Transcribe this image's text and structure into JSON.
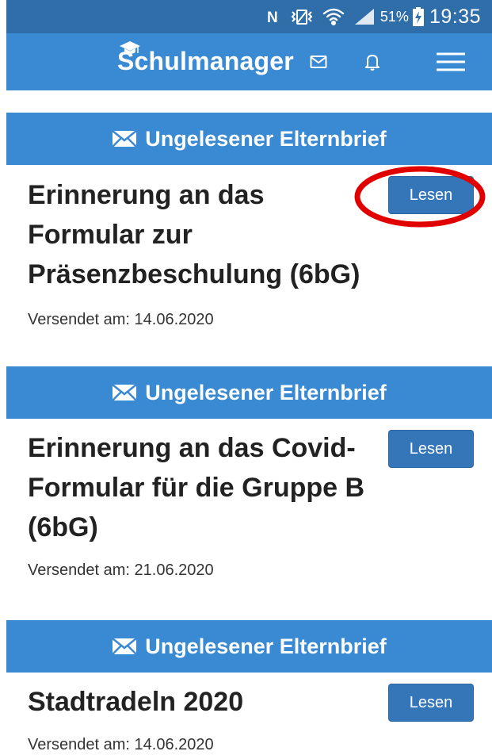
{
  "status_bar": {
    "icons": [
      "nfc-icon",
      "vibrate-icon",
      "wifi-icon",
      "signal-icon",
      "battery-charging-icon"
    ],
    "battery": "51%",
    "time": "19:35"
  },
  "header": {
    "app_name": "Schulmanager",
    "icons": [
      "graduation-cap-icon",
      "mail-icon",
      "bell-icon",
      "menu-icon"
    ]
  },
  "letters": [
    {
      "header_label": "Ungelesener Elternbrief",
      "title": "Erinnerung an das Formular zur Präsenzbeschulung (6bG)",
      "sent_label": "Versendet am: 14.06.2020",
      "button_label": "Lesen",
      "highlighted": true
    },
    {
      "header_label": "Ungelesener Elternbrief",
      "title": "Erinnerung an das Covid-Formular für die Gruppe B (6bG)",
      "sent_label": "Versendet am: 21.06.2020",
      "button_label": "Lesen",
      "highlighted": false
    },
    {
      "header_label": "Ungelesener Elternbrief",
      "title": "Stadtradeln 2020",
      "sent_label": "Versendet am: 14.06.2020",
      "button_label": "Lesen",
      "highlighted": false
    }
  ],
  "colors": {
    "status_bar": "#2f6ea8",
    "app_bar": "#3a8ad3",
    "button": "#3476b8",
    "highlight_ring": "#e00000"
  }
}
